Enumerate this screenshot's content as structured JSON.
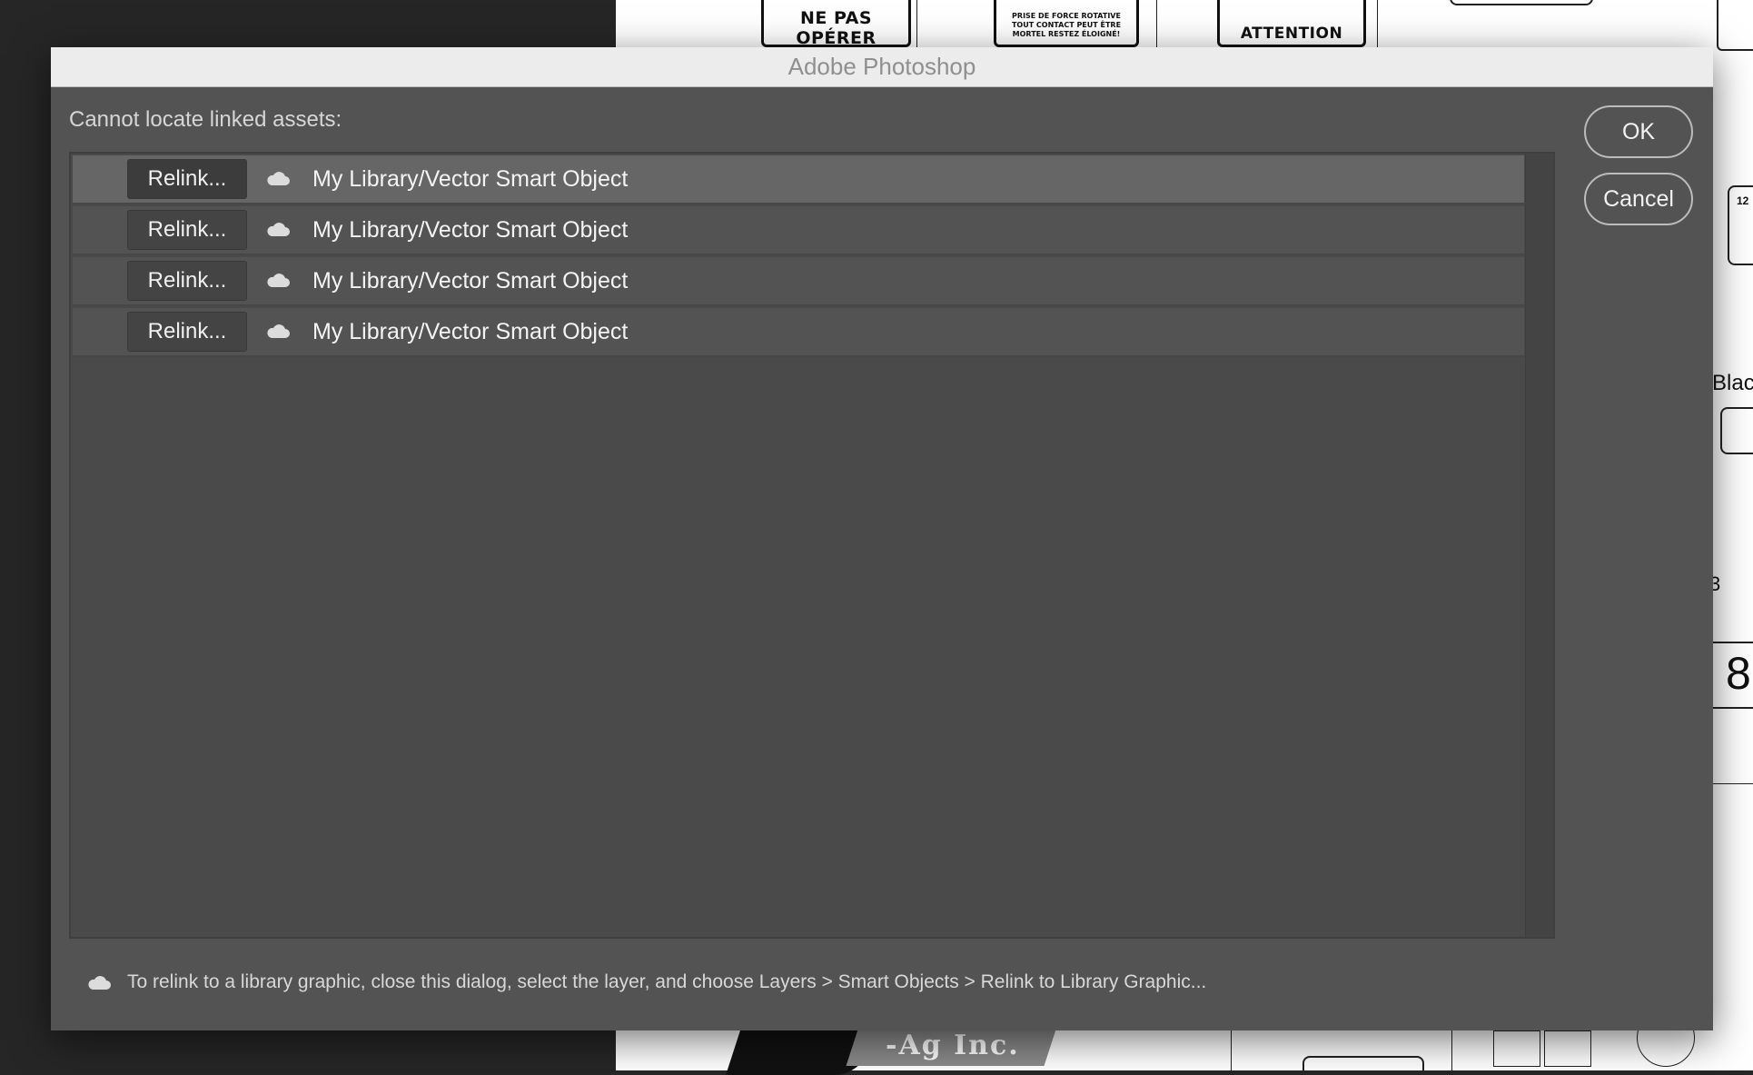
{
  "dialog": {
    "title": "Adobe Photoshop",
    "prompt": "Cannot locate linked assets:",
    "buttons": {
      "ok": "OK",
      "cancel": "Cancel"
    },
    "assets": [
      {
        "relink_label": "Relink...",
        "icon": "cloud-icon",
        "name": "My Library/Vector Smart Object",
        "selected": true
      },
      {
        "relink_label": "Relink...",
        "icon": "cloud-icon",
        "name": "My Library/Vector Smart Object",
        "selected": false
      },
      {
        "relink_label": "Relink...",
        "icon": "cloud-icon",
        "name": "My Library/Vector Smart Object",
        "selected": false
      },
      {
        "relink_label": "Relink...",
        "icon": "cloud-icon",
        "name": "My Library/Vector Smart Object",
        "selected": false
      }
    ],
    "footer_note": "To relink to a library graphic, close this dialog, select the layer, and choose Layers > Smart Objects > Relink to Library Graphic..."
  },
  "background_document": {
    "labels": [
      {
        "main": "NE PAS OPÉRER",
        "sub": ""
      },
      {
        "main": "",
        "sub": "PRISE DE FORCE ROTATIVE TOUT CONTACT PEUT ÊTRE MORTEL RESTEZ ÉLOIGNÉ!"
      },
      {
        "main": "ATTENTION",
        "sub": ""
      }
    ],
    "side_fragments": [
      "Blac",
      "8",
      "3",
      "12"
    ],
    "company_name": "-Ag Inc."
  },
  "colors": {
    "dialog_bg": "#535353",
    "list_bg": "#4a4a4a",
    "selected_row": "#666666",
    "titlebar": "#ececec"
  }
}
